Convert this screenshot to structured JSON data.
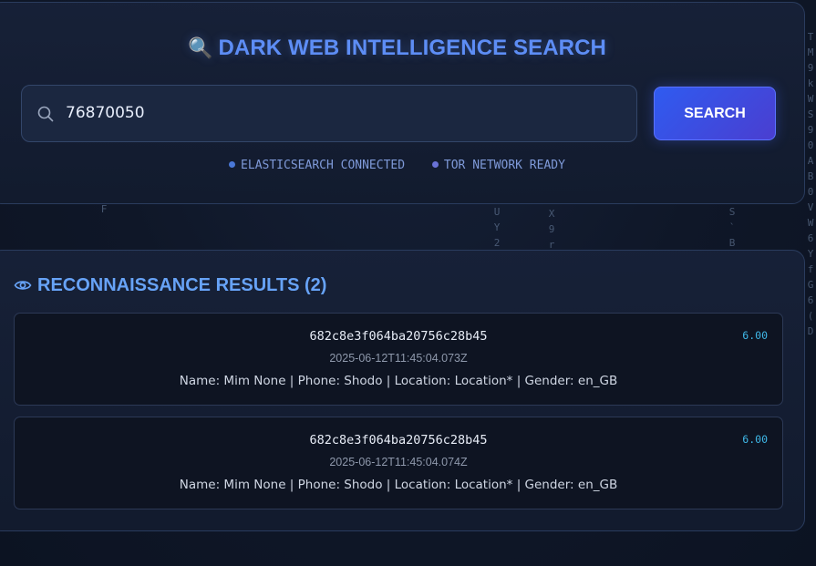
{
  "background_matrix": [
    {
      "chars": "F",
      "column": "col-a"
    },
    {
      "chars": "U\nY\n2",
      "column": "col-b"
    },
    {
      "chars": "X\n9\nr",
      "column": "col-c"
    },
    {
      "chars": "S\n`\nB",
      "column": "col-d"
    },
    {
      "chars": "T\nM\n9\nk\nW\nS\n9\n0\nA\nB\n0\nV\nW\n6\nY\nf\nG\n6\n(\nD",
      "column": "col-e"
    }
  ],
  "search_panel": {
    "title_icon": "🔍",
    "title": "DARK WEB INTELLIGENCE SEARCH",
    "search_input": {
      "value": "76870050",
      "placeholder": ""
    },
    "search_button_label": "SEARCH",
    "status_items": [
      {
        "label": "ELASTICSEARCH CONNECTED",
        "dot_color": "#4a78d8"
      },
      {
        "label": "TOR NETWORK READY",
        "dot_color": "#6a72d6"
      }
    ]
  },
  "results_panel": {
    "title": "RECONNAISSANCE RESULTS (2)",
    "results": [
      {
        "id": "682c8e3f064ba20756c28b45",
        "timestamp": "2025-06-12T11:45:04.073Z",
        "details": "Name: Mim None | Phone: Shodo | Location: Location* | Gender: en_GB",
        "score": "6.00"
      },
      {
        "id": "682c8e3f064ba20756c28b45",
        "timestamp": "2025-06-12T11:45:04.074Z",
        "details": "Name: Mim None | Phone: Shodo | Location: Location* | Gender: en_GB",
        "score": "6.00"
      }
    ]
  },
  "colors": {
    "accent": "#5d8df5",
    "results_accent": "#67a3f7",
    "score": "#3fb8e8",
    "button_start": "#2f5bf0",
    "button_end": "#4a3ed0"
  }
}
